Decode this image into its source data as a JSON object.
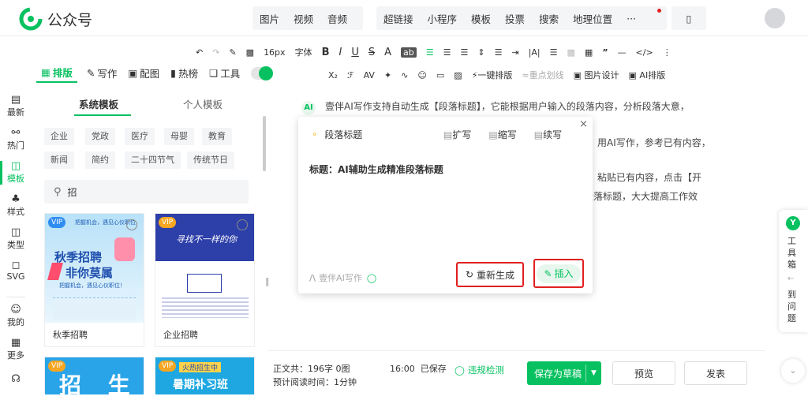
{
  "header": {
    "app_title": "公众号",
    "nav_group1": [
      "图片",
      "视频",
      "音频"
    ],
    "nav_group2": [
      "超链接",
      "小程序",
      "模板",
      "投票",
      "搜索",
      "地理位置",
      "···"
    ]
  },
  "toolbar1": {
    "font_size": "16px",
    "font_label": "字体",
    "items": [
      "B",
      "I",
      "U",
      "S",
      "A",
      "ab"
    ]
  },
  "toolbar2": {
    "one_click": "一键排版",
    "highlight": "重点划线",
    "image_design": "图片设计",
    "ai_layout": "AI排版"
  },
  "tabs": {
    "layout": "排版",
    "write": "写作",
    "image": "配图",
    "hot": "热榜",
    "tools": "工具"
  },
  "sidebar": [
    {
      "label": "最新"
    },
    {
      "label": "热门"
    },
    {
      "label": "模板"
    },
    {
      "label": "样式"
    },
    {
      "label": "类型"
    },
    {
      "label": "SVG"
    },
    {
      "label": "我的"
    },
    {
      "label": "更多"
    }
  ],
  "panel": {
    "tab_system": "系统模板",
    "tab_personal": "个人模板",
    "tags_row1": [
      "企业",
      "党政",
      "医疗",
      "母婴",
      "教育"
    ],
    "tags_row2": [
      "新闻",
      "简约",
      "二十四节气",
      "传统节日"
    ],
    "search_value": "招",
    "cards": [
      {
        "title": "秋季招聘",
        "badge": "VIP",
        "headline1": "秋季招聘",
        "headline2": "非你莫属",
        "sub": "把握机会，遇见心仪职位！",
        "top": "把握机会，遇见心仪职位"
      },
      {
        "title": "企业招聘",
        "badge": "VIP",
        "headline1": "寻找不一样的你"
      }
    ],
    "cards_row2": [
      {
        "badge": "VIP",
        "headline": "招 生"
      },
      {
        "badge": "VIP",
        "tag": "火热招生中",
        "headline": "暑期补习班"
      }
    ]
  },
  "article": {
    "line1": "壹伴AI写作支持自动生成【段落标题】，它能根据用户输入的段落内容，分析段落大意，",
    "line2": "用AI写作，参考已有内容，",
    "line3": "粘贴已有内容，点击【开",
    "line4": "段落标题，大大提高工作效"
  },
  "popup": {
    "title": "段落标题",
    "expand": "扩写",
    "shorten": "缩写",
    "continue": "续写",
    "result": "标题：AI辅助生成精准段落标题",
    "brand": "壹伴AI写作",
    "regenerate": "重新生成",
    "insert": "插入"
  },
  "footer": {
    "word_count_label": "正文共：",
    "word_count": "196字 0图",
    "read_time_label": "预计阅读时间：",
    "read_time": "1分钟",
    "save_time": "16:00",
    "saved": "已保存",
    "violation": "违规检测",
    "save_draft": "保存为草稿",
    "preview": "预览",
    "publish": "发表"
  },
  "right_widget": {
    "label": "工具箱",
    "label2": "到问题"
  },
  "colors": {
    "brand": "#07c160",
    "red": "#e02020"
  }
}
